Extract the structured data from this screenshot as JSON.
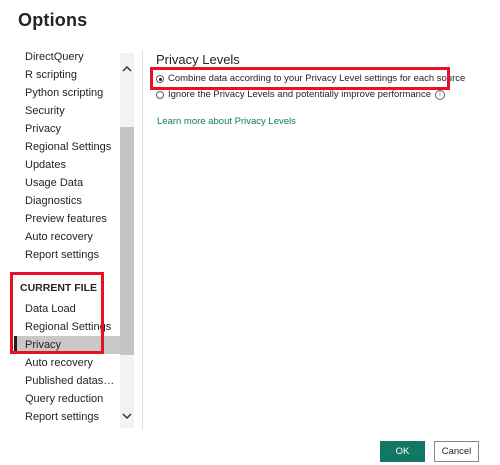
{
  "window": {
    "title": "Options"
  },
  "sidebar": {
    "global_items": [
      {
        "label": "DirectQuery"
      },
      {
        "label": "R scripting"
      },
      {
        "label": "Python scripting"
      },
      {
        "label": "Security"
      },
      {
        "label": "Privacy"
      },
      {
        "label": "Regional Settings"
      },
      {
        "label": "Updates"
      },
      {
        "label": "Usage Data"
      },
      {
        "label": "Diagnostics"
      },
      {
        "label": "Preview features"
      },
      {
        "label": "Auto recovery"
      },
      {
        "label": "Report settings"
      }
    ],
    "current_file_header": "CURRENT FILE",
    "current_file_items": [
      {
        "label": "Data Load"
      },
      {
        "label": "Regional Settings"
      },
      {
        "label": "Privacy",
        "selected": true
      },
      {
        "label": "Auto recovery"
      },
      {
        "label": "Published dataset set..."
      },
      {
        "label": "Query reduction"
      },
      {
        "label": "Report settings"
      }
    ],
    "scroll_up_icon": "chevron-up-icon",
    "scroll_down_icon": "chevron-down-icon"
  },
  "main": {
    "section_title": "Privacy Levels",
    "options": [
      {
        "label": "Combine data according to your Privacy Level settings for each source",
        "checked": true
      },
      {
        "label": "Ignore the Privacy Levels and potentially improve performance",
        "checked": false,
        "icon": "info-icon"
      }
    ],
    "learn_more_link": "Learn more about Privacy Levels"
  },
  "footer": {
    "ok_label": "OK",
    "cancel_label": "Cancel"
  },
  "colors": {
    "accent": "#117865",
    "highlight": "#e81123",
    "selected_bg": "#c8c8c8"
  }
}
